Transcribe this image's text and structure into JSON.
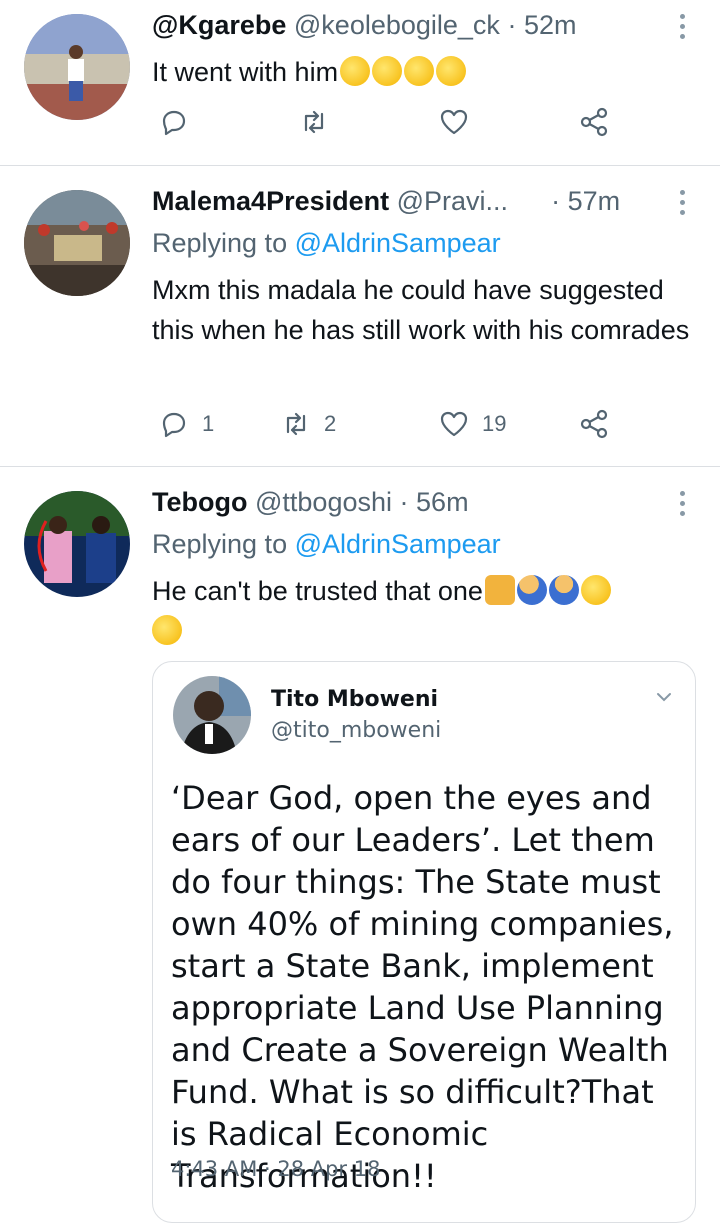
{
  "tweets": [
    {
      "name": "@Kgarebe",
      "handle": "@keolebogile_ck",
      "dot": "·",
      "time": "52m",
      "body": "It went with him",
      "emoji": [
        "rolling-on-floor-laughing",
        "rolling-on-floor-laughing",
        "rolling-on-floor-laughing",
        "rolling-on-floor-laughing"
      ],
      "actions": {
        "reply": "",
        "retweet": "",
        "like": ""
      }
    },
    {
      "name": "Malema4President",
      "handle": "@Pravi...",
      "dot": "·",
      "time": "57m",
      "replying_prefix": "Replying to",
      "replying_to": "@AldrinSampear",
      "body": "Mxm this madala he could have suggested this when he has still work with his comrades",
      "actions": {
        "reply": "1",
        "retweet": "2",
        "like": "19"
      }
    },
    {
      "name": "Tebogo",
      "handle": "@ttbogoshi",
      "dot": "·",
      "time": "56m",
      "replying_prefix": "Replying to",
      "replying_to": "@AldrinSampear",
      "body": "He can't be trusted that one",
      "emoji": [
        "backhand-index-pointing-down",
        "woman-facepalming",
        "man-shrugging",
        "smirking-face",
        "grinning-squinting-face"
      ],
      "quote": {
        "name": "Tito Mboweni",
        "handle": "@tito_mboweni",
        "text": "‘Dear God, open the eyes and ears of our Leaders’. Let them do four things: The State must own 40% of mining companies, start a State Bank, implement appropriate Land Use Planning and Create a Sovereign Wealth Fund. What is so difficult?That is Radical Economic Transformation!!",
        "timestamp": "4:43 AM · 28 Apr 18"
      }
    }
  ],
  "colors": {
    "accent": "#1d9bf0",
    "secondary_text": "#536471",
    "divider": "#dcdfe3"
  }
}
